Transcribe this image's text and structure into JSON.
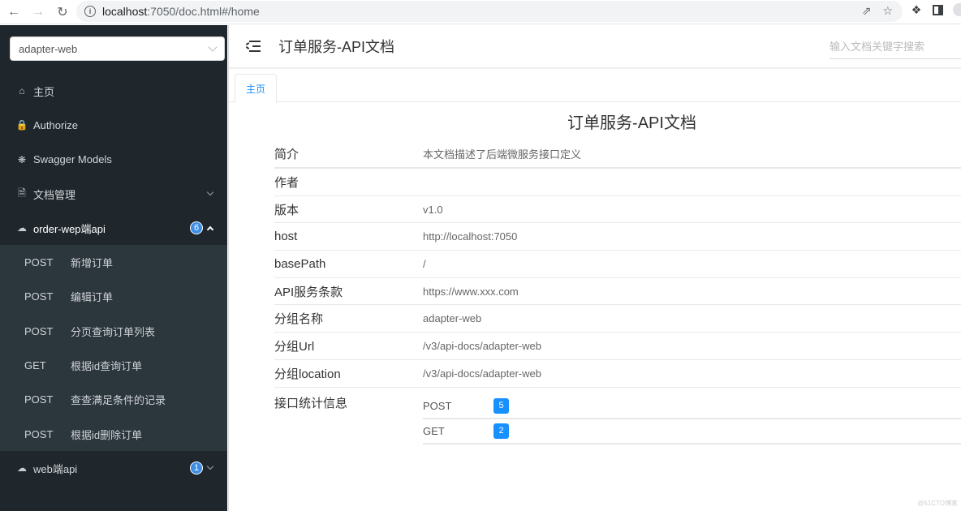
{
  "browser": {
    "url_host": "localhost",
    "url_path": ":7050/doc.html#/home"
  },
  "sidebar": {
    "group_select": "adapter-web",
    "items": [
      {
        "label": "主页",
        "icon": "home-icon"
      },
      {
        "label": "Authorize",
        "icon": "lock-icon"
      },
      {
        "label": "Swagger Models",
        "icon": "cube-icon"
      },
      {
        "label": "文档管理",
        "icon": "doc-settings-icon"
      },
      {
        "label": "order-wep端api",
        "icon": "cloud-icon",
        "count": "6"
      },
      {
        "label": "web端api",
        "icon": "cloud-icon",
        "count": "1"
      }
    ],
    "order_api_endpoints": [
      {
        "method": "POST",
        "name": "新增订单"
      },
      {
        "method": "POST",
        "name": "编辑订单"
      },
      {
        "method": "POST",
        "name": "分页查询订单列表"
      },
      {
        "method": "GET",
        "name": "根据id查询订单"
      },
      {
        "method": "POST",
        "name": "查查满足条件的记录"
      },
      {
        "method": "POST",
        "name": "根据id删除订单"
      }
    ]
  },
  "header": {
    "title": "订单服务-API文档",
    "search_placeholder": "输入文档关键字搜索"
  },
  "tabs": [
    {
      "label": "主页"
    }
  ],
  "doc": {
    "title": "订单服务-API文档",
    "rows": [
      {
        "label": "简介",
        "value": "本文档描述了后端微服务接口定义"
      },
      {
        "label": "作者",
        "value": ""
      },
      {
        "label": "版本",
        "value": "v1.0"
      },
      {
        "label": "host",
        "value": "http://localhost:7050"
      },
      {
        "label": "basePath",
        "value": "/"
      },
      {
        "label": "API服务条款",
        "value": "https://www.xxx.com"
      },
      {
        "label": "分组名称",
        "value": "adapter-web"
      },
      {
        "label": "分组Url",
        "value": "/v3/api-docs/adapter-web"
      },
      {
        "label": "分组location",
        "value": "/v3/api-docs/adapter-web"
      }
    ],
    "stats_label": "接口统计信息",
    "stats": [
      {
        "method": "POST",
        "count": "5"
      },
      {
        "method": "GET",
        "count": "2"
      }
    ]
  },
  "watermark": "@51CTO博客",
  "colors": {
    "sidebar_bg": "#1f272d",
    "submenu_bg": "#2b363d",
    "accent": "#1890ff",
    "count_badge": "#3c8de5"
  }
}
